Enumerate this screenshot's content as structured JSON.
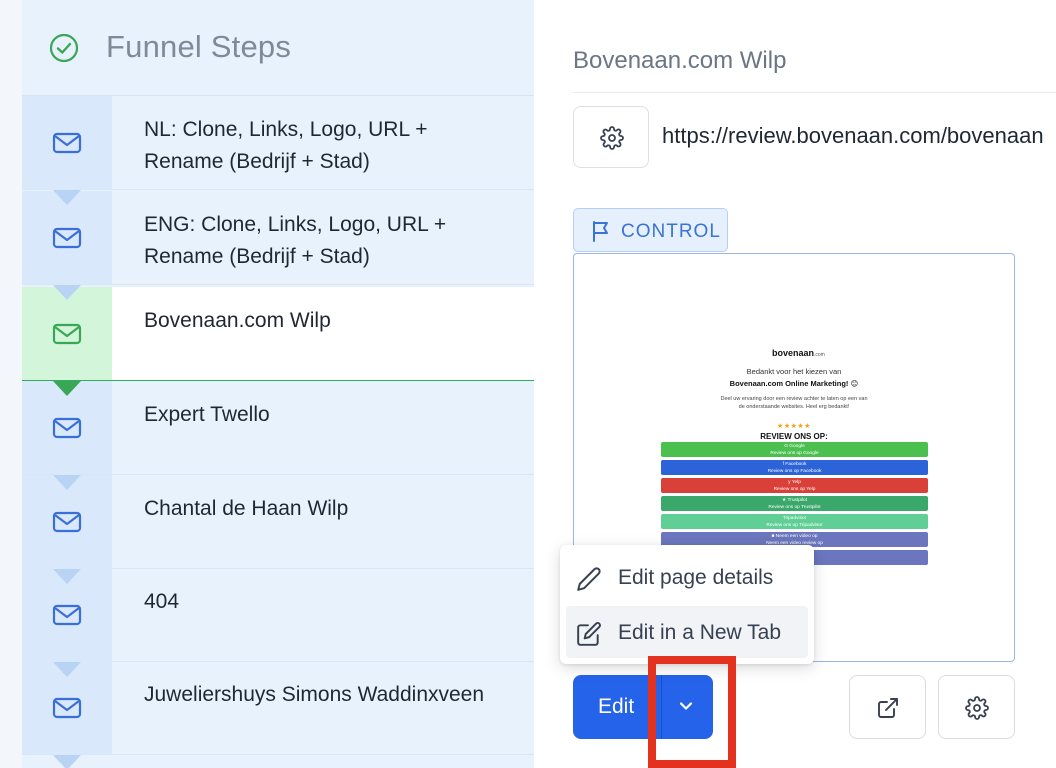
{
  "sidebar": {
    "title": "Funnel Steps",
    "steps": [
      {
        "label": "NL: Clone, Links, Logo, URL + Rename (Bedrijf + Stad)",
        "active": false
      },
      {
        "label": "ENG: Clone, Links, Logo, URL + Rename (Bedrijf + Stad)",
        "active": false
      },
      {
        "label": "Bovenaan.com Wilp",
        "active": true
      },
      {
        "label": "Expert Twello",
        "active": false
      },
      {
        "label": "Chantal de Haan Wilp",
        "active": false
      },
      {
        "label": "404",
        "active": false
      },
      {
        "label": "Juweliershuys Simons Waddinxveen",
        "active": false
      }
    ]
  },
  "main": {
    "page_title": "Bovenaan.com Wilp",
    "url": "https://review.bovenaan.com/bovenaan",
    "badge": "CONTROL",
    "preview": {
      "logo": "bovenaan",
      "logo_suffix": ".com",
      "line1": "Bedankt voor het kiezen van",
      "line2": "Bovenaan.com Online Marketing! 😊",
      "line3a": "Deel uw ervaring door een review achter te laten op een van",
      "line3b": "de onderstaande websites. Heel erg bedankt!",
      "stars": "★★★★★",
      "review_heading": "REVIEW ONS OP:",
      "buttons": [
        {
          "label": "G Google",
          "sub": "Review ons op Google",
          "color": "#4cc04f"
        },
        {
          "label": "f Facebook",
          "sub": "Review ons op Facebook",
          "color": "#2d63d8"
        },
        {
          "label": "y Yelp",
          "sub": "Review ons op Yelp",
          "color": "#d9403a"
        },
        {
          "label": "★ Trustpilot",
          "sub": "Review ons op Trustpilot",
          "color": "#3aa86b"
        },
        {
          "label": "Tripadvisor",
          "sub": "Review ons op Tripadvisor",
          "color": "#5fcf95"
        },
        {
          "label": "■ Neem een video op",
          "sub": "Neem een video review op",
          "color": "#6b76be"
        },
        {
          "label": "",
          "sub": "",
          "color": "#6b76be"
        }
      ]
    }
  },
  "menu": {
    "items": [
      {
        "label": "Edit page details",
        "icon": "pencil-icon"
      },
      {
        "label": "Edit in a New Tab",
        "icon": "edit-square-icon"
      }
    ]
  },
  "actions": {
    "edit_label": "Edit"
  },
  "colors": {
    "primary": "#2563eb",
    "active_green": "#3aa757",
    "highlight": "#e3331f"
  }
}
